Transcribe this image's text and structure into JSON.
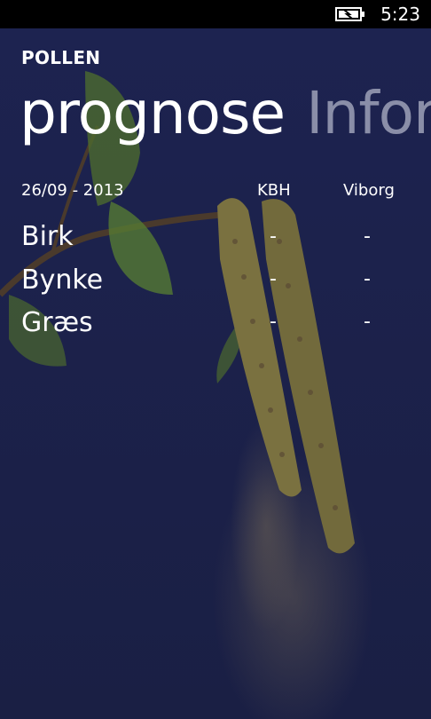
{
  "status_bar": {
    "battery_icon": "battery-charging-icon",
    "time": "5:23"
  },
  "app": {
    "title": "POLLEN"
  },
  "pivot": {
    "active": "prognose",
    "next": "Infor"
  },
  "forecast": {
    "date": "26/09 - 2013",
    "columns": [
      "KBH",
      "Viborg"
    ],
    "rows": [
      {
        "label": "Birk",
        "values": [
          "-",
          "-"
        ]
      },
      {
        "label": "Bynke",
        "values": [
          "-",
          "-"
        ]
      },
      {
        "label": "Græs",
        "values": [
          "-",
          "-"
        ]
      }
    ]
  },
  "colors": {
    "background": "#1b2148",
    "status_bar": "#000000",
    "text": "#ffffff",
    "inactive_pivot": "#8a8ea8"
  }
}
